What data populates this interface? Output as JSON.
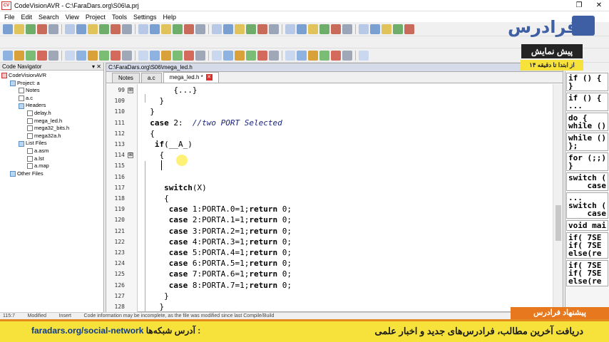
{
  "window": {
    "title": "CodeVisionAVR - C:\\FaraDars.org\\S06\\a.prj",
    "logo_text": "CV\nAVR"
  },
  "menu": [
    "File",
    "Edit",
    "Search",
    "View",
    "Project",
    "Tools",
    "Settings",
    "Help"
  ],
  "navigator": {
    "title": "Code Navigator",
    "items": [
      {
        "label": "CodeVisionAVR",
        "indent": 0,
        "kind": "cv"
      },
      {
        "label": "Project: a",
        "indent": 1,
        "kind": "folder"
      },
      {
        "label": "Notes",
        "indent": 2,
        "kind": "file"
      },
      {
        "label": "a.c",
        "indent": 2,
        "kind": "file"
      },
      {
        "label": "Headers",
        "indent": 2,
        "kind": "folder"
      },
      {
        "label": "delay.h",
        "indent": 3,
        "kind": "file"
      },
      {
        "label": "mega_led.h",
        "indent": 3,
        "kind": "file"
      },
      {
        "label": "mega32_bits.h",
        "indent": 3,
        "kind": "file"
      },
      {
        "label": "mega32a.h",
        "indent": 3,
        "kind": "file"
      },
      {
        "label": "List Files",
        "indent": 2,
        "kind": "folder"
      },
      {
        "label": "a.asm",
        "indent": 3,
        "kind": "file"
      },
      {
        "label": "a.lst",
        "indent": 3,
        "kind": "file"
      },
      {
        "label": "a.map",
        "indent": 3,
        "kind": "file"
      },
      {
        "label": "Other Files",
        "indent": 1,
        "kind": "folder"
      }
    ]
  },
  "editor": {
    "path": "C:\\FaraDars.org\\S06\\mega_led.h",
    "tabs": [
      "Notes",
      "a.c",
      "mega_led.h *"
    ],
    "active_tab": 2,
    "close_glyph": "✕",
    "lines": [
      {
        "n": "99",
        "text": "       {...}",
        "fold": true
      },
      {
        "n": "109",
        "text": "    }",
        "fold": false
      },
      {
        "n": "110",
        "text": "  }",
        "fold": false
      },
      {
        "n": "111",
        "text": "  case 2:  //two PORT Selected",
        "fold": false
      },
      {
        "n": "112",
        "text": "  {",
        "fold": false
      },
      {
        "n": "113",
        "text": "   if(__A_)",
        "fold": false
      },
      {
        "n": "114",
        "text": "    {",
        "fold": true
      },
      {
        "n": "115",
        "text": "",
        "fold": false
      },
      {
        "n": "116",
        "text": "",
        "fold": false
      },
      {
        "n": "117",
        "text": "     switch(X)",
        "fold": false
      },
      {
        "n": "118",
        "text": "     {",
        "fold": false
      },
      {
        "n": "119",
        "text": "      case 1:PORTA.0=1;return 0;",
        "fold": false
      },
      {
        "n": "120",
        "text": "      case 2:PORTA.1=1;return 0;",
        "fold": false
      },
      {
        "n": "121",
        "text": "      case 3:PORTA.2=1;return 0;",
        "fold": false
      },
      {
        "n": "122",
        "text": "      case 4:PORTA.3=1;return 0;",
        "fold": false
      },
      {
        "n": "123",
        "text": "      case 5:PORTA.4=1;return 0;",
        "fold": false
      },
      {
        "n": "124",
        "text": "      case 6:PORTA.5=1;return 0;",
        "fold": false
      },
      {
        "n": "125",
        "text": "      case 7:PORTA.6=1;return 0;",
        "fold": false
      },
      {
        "n": "126",
        "text": "      case 8:PORTA.7=1;return 0;",
        "fold": false
      },
      {
        "n": "127",
        "text": "     }",
        "fold": false
      },
      {
        "n": "128",
        "text": "    }",
        "fold": false
      }
    ]
  },
  "snippets": [
    "if () {\n}",
    "if () {\n...",
    "do {\nwhile ()",
    "while ()\n};",
    "for (;;)\n}",
    "switch (\n    case",
    "...\nswitch (\n    case",
    "void mai",
    "if( 7SE\nif( 7SE\nelse(re",
    "if( 7SE\nif( 7SE\nelse(re"
  ],
  "status": {
    "position": "115:7",
    "state": "Modified",
    "mode": "Insert",
    "message": "Code information may be incomplete, as the file was modified since last Compile/Build"
  },
  "branding": {
    "logo_text": "فرادرس",
    "preview_title": "پیش نمایش",
    "preview_subtitle": "از ابتدا تا دقیقه ۱۴",
    "promo_tab": "پیشنهاد فرادرس",
    "promo_right": "دریافت آخرین مطالب، فرادرس‌های جدید و اخبار علمی",
    "social_label": "آدرس شبکه‌ها :",
    "social_url": "faradars.org/social-network"
  },
  "colors": {
    "promo_bg": "#f6e23a",
    "promo_accent": "#e8781e",
    "brand_blue": "#3e5fa4",
    "comment": "#1a237e"
  }
}
